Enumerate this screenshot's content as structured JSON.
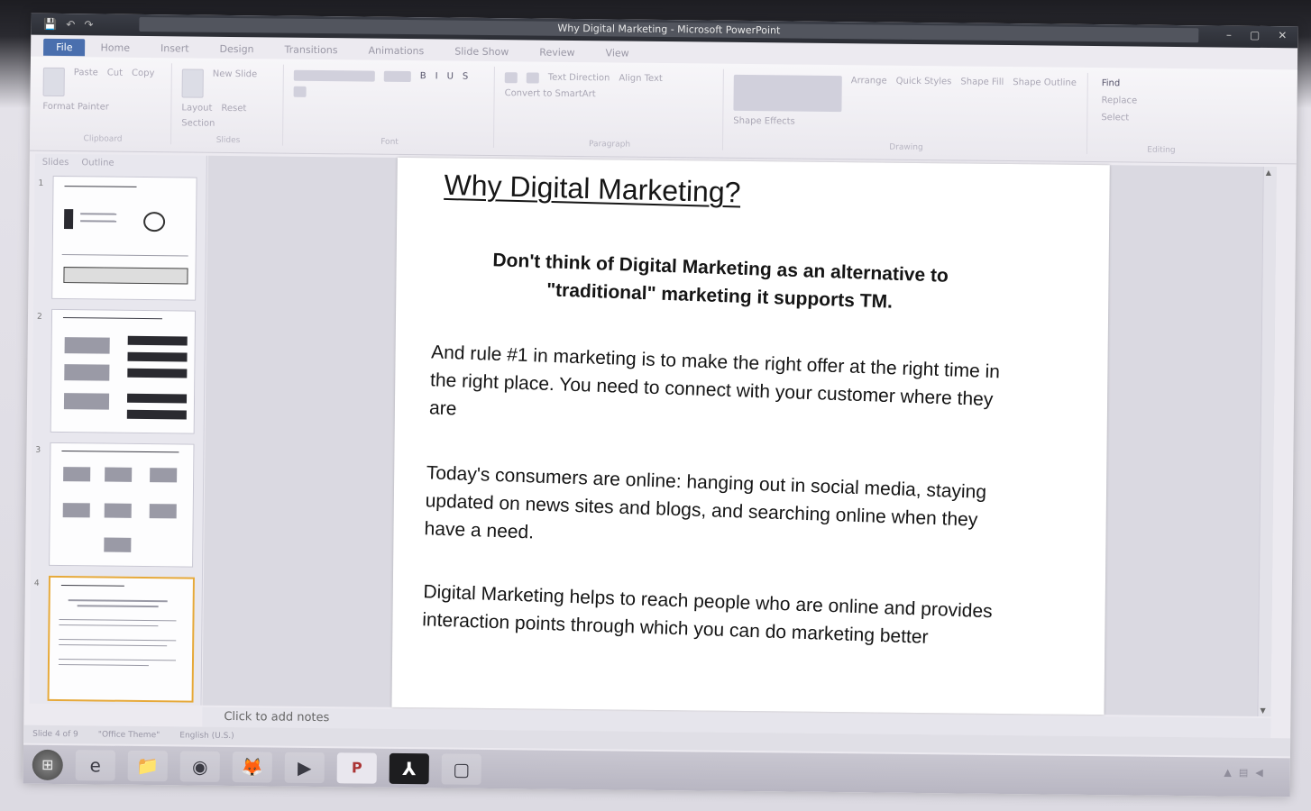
{
  "window": {
    "title": "Why Digital Marketing - Microsoft PowerPoint",
    "qat": [
      "💾",
      "↶",
      "↷"
    ],
    "controls": [
      "–",
      "▢",
      "✕"
    ]
  },
  "tabs": {
    "file": "File",
    "items": [
      "Home",
      "Insert",
      "Design",
      "Transitions",
      "Animations",
      "Slide Show",
      "Review",
      "View"
    ]
  },
  "ribbon": {
    "clipboard": {
      "label": "Clipboard",
      "paste": "Paste",
      "cut": "Cut",
      "copy": "Copy",
      "format_painter": "Format Painter"
    },
    "slides": {
      "label": "Slides",
      "new_slide": "New Slide",
      "layout": "Layout",
      "reset": "Reset",
      "section": "Section"
    },
    "font": {
      "label": "Font",
      "bold": "B",
      "italic": "I",
      "underline": "U",
      "shadow": "S"
    },
    "paragraph": {
      "label": "Paragraph",
      "text_direction": "Text Direction",
      "align_text": "Align Text",
      "convert": "Convert to SmartArt"
    },
    "drawing": {
      "label": "Drawing",
      "arrange": "Arrange",
      "quick_styles": "Quick Styles",
      "shape_fill": "Shape Fill",
      "shape_outline": "Shape Outline",
      "shape_effects": "Shape Effects"
    },
    "editing": {
      "label": "Editing",
      "find": "Find",
      "replace": "Replace",
      "select": "Select"
    }
  },
  "left_panel": {
    "tabs": [
      "Slides",
      "Outline"
    ],
    "slide_numbers": [
      "1",
      "2",
      "3",
      "4"
    ]
  },
  "slide": {
    "title": "Why Digital Marketing?",
    "intro": "Don't think of Digital Marketing as an alternative to \"traditional\" marketing it supports TM.",
    "p1": "And rule #1 in marketing is to make the right offer at the right time in the right place. You need to connect with your customer where they are",
    "p2": "Today's consumers are online: hanging out in social media, staying updated on news sites and blogs, and searching online when they have a need.",
    "p3": "Digital Marketing helps to reach people who are online and provides interaction points through which you can do marketing better"
  },
  "notes": {
    "placeholder": "Click to add notes"
  },
  "status": {
    "slide_info": "Slide 4 of 9",
    "theme": "\"Office Theme\"",
    "language": "English (U.S.)"
  },
  "taskbar": {
    "start": "⊞",
    "items": [
      {
        "name": "ie",
        "glyph": "e"
      },
      {
        "name": "folder",
        "glyph": "📁"
      },
      {
        "name": "chrome",
        "glyph": "◉"
      },
      {
        "name": "firefox",
        "glyph": "🦊"
      },
      {
        "name": "media",
        "glyph": "▶"
      },
      {
        "name": "powerpoint",
        "glyph": "P"
      },
      {
        "name": "acrobat",
        "glyph": "⅄"
      },
      {
        "name": "app",
        "glyph": "▢"
      }
    ]
  }
}
